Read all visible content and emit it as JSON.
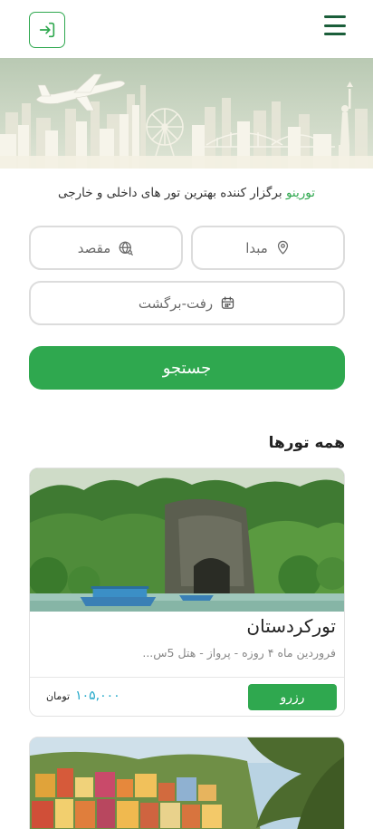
{
  "header": {
    "login_icon": "login-arrow-icon",
    "menu_icon": "hamburger-menu-icon"
  },
  "tagline": {
    "brand": "تورینو",
    "text": " برگزار کننده بهترین تور های داخلی و خارجی"
  },
  "search": {
    "origin_label": "مبدا",
    "destination_label": "مقصد",
    "date_label": "رفت-برگشت",
    "search_label": "جستجو"
  },
  "tours": {
    "section_title": "همه تورها",
    "items": [
      {
        "title": "تورکردستان",
        "description": "فروردین ماه ۴ روزه - پرواز - هتل 5س...",
        "reserve_label": "رزرو",
        "price": "۱۰۵,۰۰۰",
        "currency": "تومان"
      }
    ]
  },
  "colors": {
    "accent": "#2fa84f",
    "price": "#1fa7c9",
    "menu": "#1b5e3a"
  }
}
